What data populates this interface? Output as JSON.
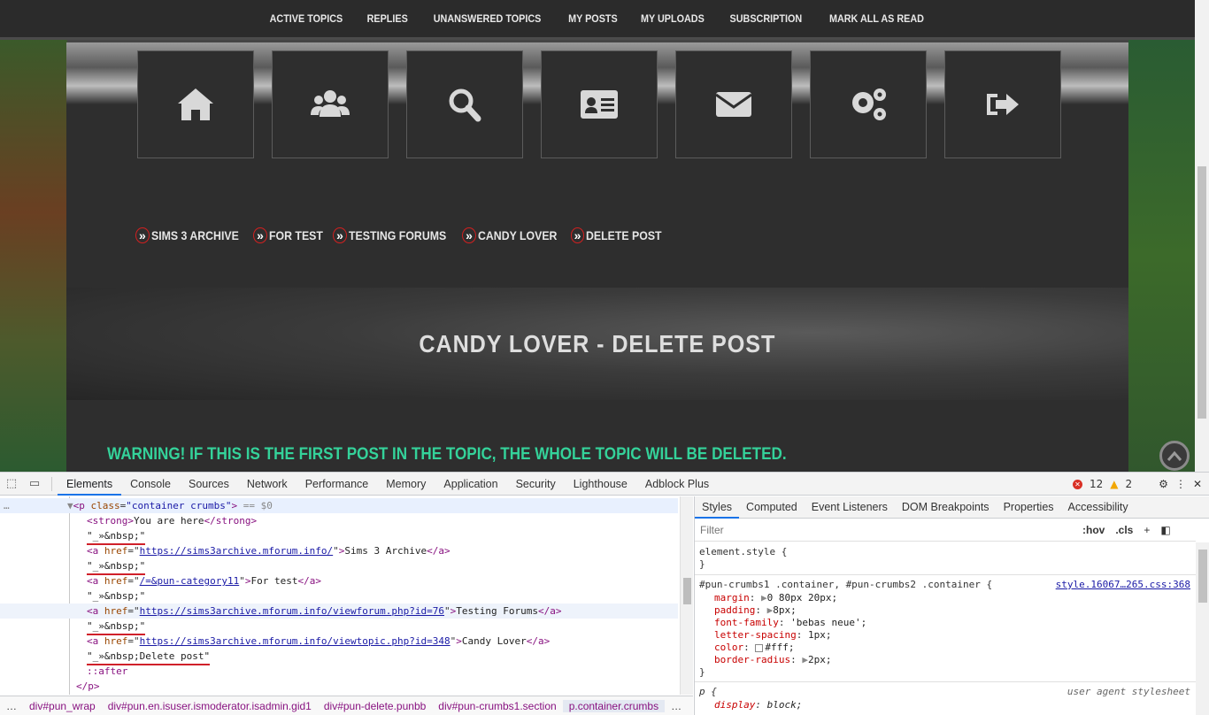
{
  "nav": [
    "ACTIVE TOPICS",
    "REPLIES",
    "UNANSWERED TOPICS",
    "MY POSTS",
    "MY UPLOADS",
    "SUBSCRIPTION",
    "MARK ALL AS READ"
  ],
  "icons": [
    "home-icon",
    "users-icon",
    "search-icon",
    "profile-card-icon",
    "envelope-icon",
    "gears-icon",
    "logout-icon"
  ],
  "breadcrumbs": {
    "sep": "»",
    "items": [
      "SIMS 3 ARCHIVE",
      "FOR TEST",
      "TESTING FORUMS",
      "CANDY LOVER",
      "DELETE POST"
    ]
  },
  "hero_title": "CANDY LOVER - DELETE POST",
  "warning": "WARNING! IF THIS IS THE FIRST POST IN THE TOPIC, THE WHOLE TOPIC WILL BE DELETED.",
  "colors": {
    "warning": "#34d29a",
    "accent": "#1a73e8",
    "annotation": "#d0202a"
  },
  "devtools": {
    "tabs": [
      "Elements",
      "Console",
      "Sources",
      "Network",
      "Performance",
      "Memory",
      "Application",
      "Security",
      "Lighthouse",
      "Adblock Plus"
    ],
    "active_tab": "Elements",
    "errors": "12",
    "warnings": "2",
    "dom": {
      "root": "container crumbs",
      "root_suffix": "== $0",
      "strong_text": "You are here",
      "nbsp_text": "\"_»&nbsp;\"",
      "links": [
        {
          "href": "https://sims3archive.mforum.info/",
          "text": "Sims 3 Archive"
        },
        {
          "href": "/=&pun-category11",
          "text": "For test"
        },
        {
          "href": "https://sims3archive.mforum.info/viewforum.php?id=76",
          "text": "Testing Forums"
        },
        {
          "href": "https://sims3archive.mforum.info/viewtopic.php?id=348",
          "text": "Candy Lover"
        }
      ],
      "last_text": "\"_»&nbsp;Delete post\"",
      "after": "::after",
      "close": "</p>"
    },
    "crumb_path": [
      "div#pun_wrap",
      "div#pun.en.isuser.ismoderator.isadmin.gid1",
      "div#pun-delete.punbb",
      "div#pun-crumbs1.section",
      "p.container.crumbs"
    ],
    "styles_tabs": [
      "Styles",
      "Computed",
      "Event Listeners",
      "DOM Breakpoints",
      "Properties",
      "Accessibility"
    ],
    "filter_placeholder": "Filter",
    "hov": ":hov",
    "cls": ".cls",
    "element_style": "element.style {",
    "rule_selector": "#pun-crumbs1 .container, #pun-crumbs2 .container {",
    "rule_source": "style.16067…265.css:368",
    "rule_props": [
      {
        "name": "margin",
        "value": "0 80px 20px;"
      },
      {
        "name": "padding",
        "value": "8px;"
      },
      {
        "name": "font-family",
        "value": "'bebas neue';"
      },
      {
        "name": "letter-spacing",
        "value": "1px;"
      },
      {
        "name": "color",
        "value": "#fff;"
      },
      {
        "name": "border-radius",
        "value": "2px;"
      }
    ],
    "ua_selector": "p {",
    "ua_source": "user agent stylesheet",
    "ua_prop": {
      "name": "display",
      "value": "block;"
    }
  }
}
